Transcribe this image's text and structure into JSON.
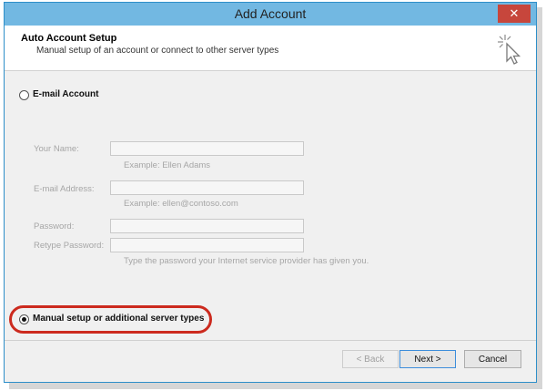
{
  "window": {
    "title": "Add Account",
    "close_glyph": "✕"
  },
  "header": {
    "title": "Auto Account Setup",
    "subtitle": "Manual setup of an account or connect to other server types",
    "icon": "wizard-cursor-icon"
  },
  "options": {
    "email_account": {
      "label": "E-mail Account",
      "selected": false
    },
    "manual_setup": {
      "label": "Manual setup or additional server types",
      "selected": true
    }
  },
  "form": {
    "your_name": {
      "label": "Your Name:",
      "value": "",
      "hint": "Example: Ellen Adams"
    },
    "email_address": {
      "label": "E-mail Address:",
      "value": "",
      "hint": "Example: ellen@contoso.com"
    },
    "password": {
      "label": "Password:",
      "value": ""
    },
    "retype_password": {
      "label": "Retype Password:",
      "value": "",
      "hint": "Type the password your Internet service provider has given you."
    }
  },
  "buttons": {
    "back": "< Back",
    "next": "Next >",
    "cancel": "Cancel"
  },
  "colors": {
    "title_bar": "#72b8e2",
    "close_button": "#c7463c",
    "highlight": "#cc2a1e"
  }
}
